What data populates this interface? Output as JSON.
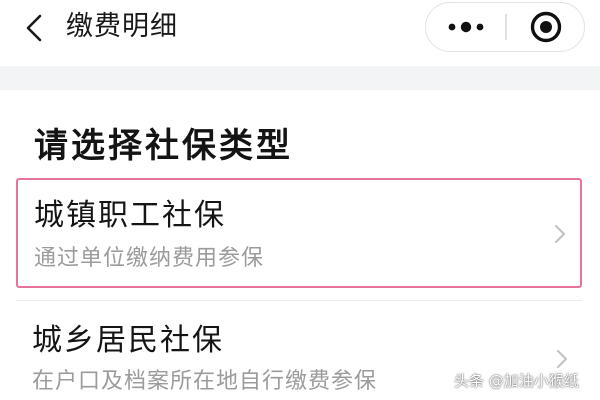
{
  "navbar": {
    "title": "缴费明细",
    "back_icon": "chevron-left-icon",
    "more_icon": "more-dots-icon",
    "close_icon": "target-close-icon"
  },
  "section": {
    "heading": "请选择社保类型"
  },
  "options": [
    {
      "title": "城镇职工社保",
      "subtitle": "通过单位缴纳费用参保",
      "highlighted": true,
      "highlight_color": "#e8739a"
    },
    {
      "title": "城乡居民社保",
      "subtitle": "在户口及档案所在地自行缴费参保",
      "highlighted": false
    }
  ],
  "watermark": {
    "text": "头条 @加油小猴纸"
  },
  "colors": {
    "background": "#ffffff",
    "band": "#f2f4f5",
    "title_text": "#151515",
    "sub_text": "#9b9b9b",
    "chevron": "#c4c4c4"
  }
}
